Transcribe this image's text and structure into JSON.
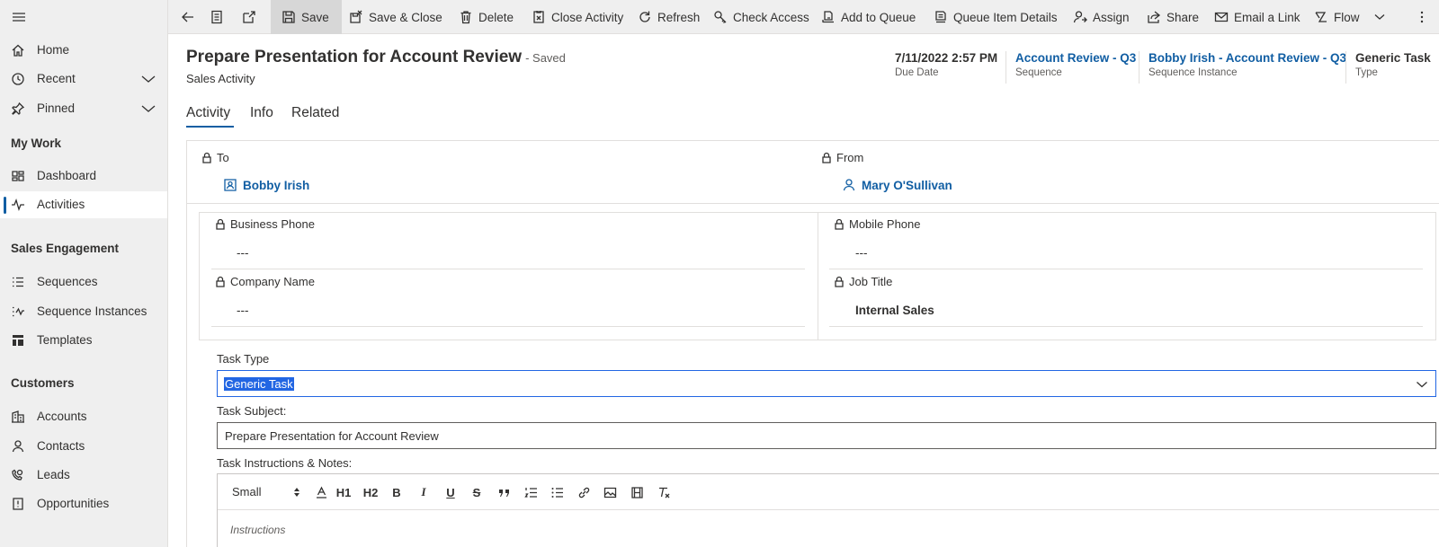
{
  "sidebar": {
    "items_top": [
      {
        "label": "Home",
        "icon": "home-icon"
      },
      {
        "label": "Recent",
        "icon": "clock-icon"
      },
      {
        "label": "Pinned",
        "icon": "pin-icon"
      }
    ],
    "sections": [
      {
        "title": "My Work",
        "items": [
          {
            "label": "Dashboard",
            "icon": "dashboard-icon"
          },
          {
            "label": "Activities",
            "icon": "activity-icon",
            "active": true
          }
        ]
      },
      {
        "title": "Sales Engagement",
        "items": [
          {
            "label": "Sequences",
            "icon": "list-icon"
          },
          {
            "label": "Sequence Instances",
            "icon": "sequence-instance-icon"
          },
          {
            "label": "Templates",
            "icon": "template-icon"
          }
        ]
      },
      {
        "title": "Customers",
        "items": [
          {
            "label": "Accounts",
            "icon": "building-icon"
          },
          {
            "label": "Contacts",
            "icon": "person-icon"
          },
          {
            "label": "Leads",
            "icon": "phone-person-icon"
          },
          {
            "label": "Opportunities",
            "icon": "opportunity-icon"
          }
        ]
      }
    ]
  },
  "toolbar": {
    "save": "Save",
    "save_close": "Save & Close",
    "delete": "Delete",
    "close_activity": "Close Activity",
    "refresh": "Refresh",
    "check_access": "Check Access",
    "add_to_queue": "Add to Queue",
    "queue_item_details": "Queue Item Details",
    "assign": "Assign",
    "share": "Share",
    "email_link": "Email a Link",
    "flow": "Flow"
  },
  "header": {
    "title": "Prepare Presentation for Account Review",
    "status": "- Saved",
    "entity": "Sales Activity",
    "fields": {
      "due_date": {
        "value": "7/11/2022 2:57 PM",
        "label": "Due Date"
      },
      "sequence": {
        "value": "Account Review - Q3",
        "label": "Sequence"
      },
      "sequence_instance": {
        "value": "Bobby Irish - Account Review - Q3",
        "label": "Sequence Instance"
      },
      "type": {
        "value": "Generic Task",
        "label": "Type"
      }
    }
  },
  "tabs": {
    "activity": "Activity",
    "info": "Info",
    "related": "Related"
  },
  "form": {
    "to_label": "To",
    "to_value": "Bobby Irish",
    "from_label": "From",
    "from_value": "Mary O'Sullivan",
    "business_phone_label": "Business Phone",
    "business_phone_value": "---",
    "mobile_phone_label": "Mobile Phone",
    "mobile_phone_value": "---",
    "company_name_label": "Company Name",
    "company_name_value": "---",
    "job_title_label": "Job Title",
    "job_title_value": "Internal Sales",
    "task_type_label": "Task Type",
    "task_type_value": "Generic Task",
    "task_subject_label": "Task Subject:",
    "task_subject_value": "Prepare Presentation for Account Review",
    "task_notes_label": "Task Instructions & Notes:",
    "editor": {
      "font_size": "Small",
      "h1": "H1",
      "h2": "H2",
      "bold": "B",
      "italic": "I",
      "underline": "U",
      "strike": "S",
      "placeholder": "Instructions"
    }
  }
}
